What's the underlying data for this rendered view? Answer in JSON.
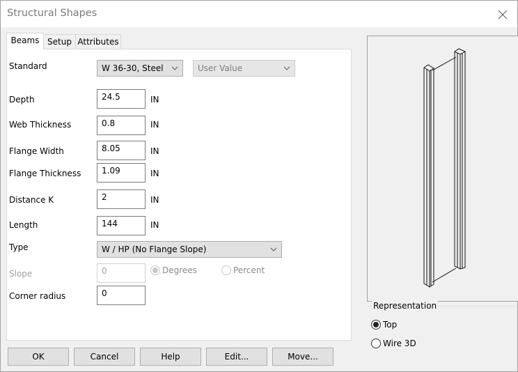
{
  "window": {
    "title": "Structural Shapes",
    "close_icon": "close-icon"
  },
  "tabs": [
    {
      "label": "Beams",
      "active": true
    },
    {
      "label": "Setup",
      "active": false
    },
    {
      "label": "Attributes",
      "active": false
    }
  ],
  "form": {
    "standard": {
      "label": "Standard",
      "value": "W 36-30, Steel",
      "secondary_value": "User Value"
    },
    "depth": {
      "label": "Depth",
      "value": "24.5",
      "unit": "IN"
    },
    "web_thickness": {
      "label": "Web Thickness",
      "value": "0.8",
      "unit": "IN"
    },
    "flange_width": {
      "label": "Flange Width",
      "value": "8.05",
      "unit": "IN"
    },
    "flange_thickness": {
      "label": "Flange Thickness",
      "value": "1.09",
      "unit": "IN"
    },
    "distance_k": {
      "label": "Distance K",
      "value": "2",
      "unit": "IN"
    },
    "length": {
      "label": "Length",
      "value": "144",
      "unit": "IN"
    },
    "type": {
      "label": "Type",
      "value": "W / HP (No Flange Slope)"
    },
    "slope": {
      "label": "Slope",
      "value": "0",
      "degrees_label": "Degrees",
      "percent_label": "Percent",
      "selected": "Degrees"
    },
    "corner_radius": {
      "label": "Corner radius",
      "value": "0"
    }
  },
  "buttons": {
    "ok": "OK",
    "cancel": "Cancel",
    "help": "Help",
    "edit": "Edit...",
    "move": "Move..."
  },
  "representation": {
    "title": "Representation",
    "top_label": "Top",
    "wire3d_label": "Wire 3D",
    "selected": "Top"
  }
}
